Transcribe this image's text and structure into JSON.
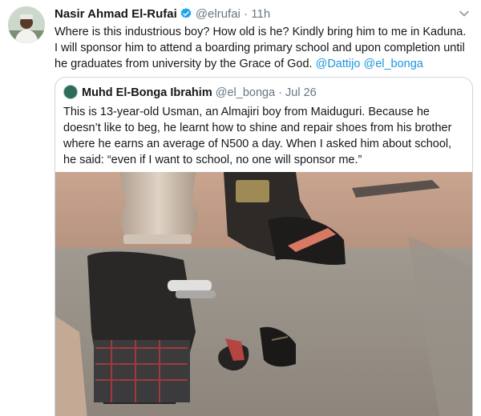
{
  "tweet": {
    "author_name": "Nasir Ahmad El-Rufai",
    "handle": "@elrufai",
    "separator": "·",
    "time": "11h",
    "text_plain": "Where is this industrious boy? How old is he? Kindly bring him to me in Kaduna. I will sponsor him to attend a boarding primary school and upon completion until he graduates from university by the Grace of God. ",
    "mention_1": "@Dattijo",
    "mention_2": "@el_bonga"
  },
  "quoted_tweet": {
    "author_name": "Muhd El-Bonga Ibrahim",
    "handle": "@el_bonga",
    "separator": "·",
    "time": "Jul 26",
    "text": "This is 13-year-old Usman, an Almajiri boy from Maiduguri. Because he doesn’t like to beg, he learnt how to shine and repair shoes from his brother where he earns an average of N500 a day. When I asked him about school, he said: “even if I want to school, no one will sponsor me.”"
  },
  "colors": {
    "link": "#1b95e0",
    "secondary_text": "#657786",
    "border": "#ccd6dd",
    "verified": "#1da1f2"
  },
  "icons": [
    "verified-badge-icon",
    "chevron-down-icon"
  ]
}
